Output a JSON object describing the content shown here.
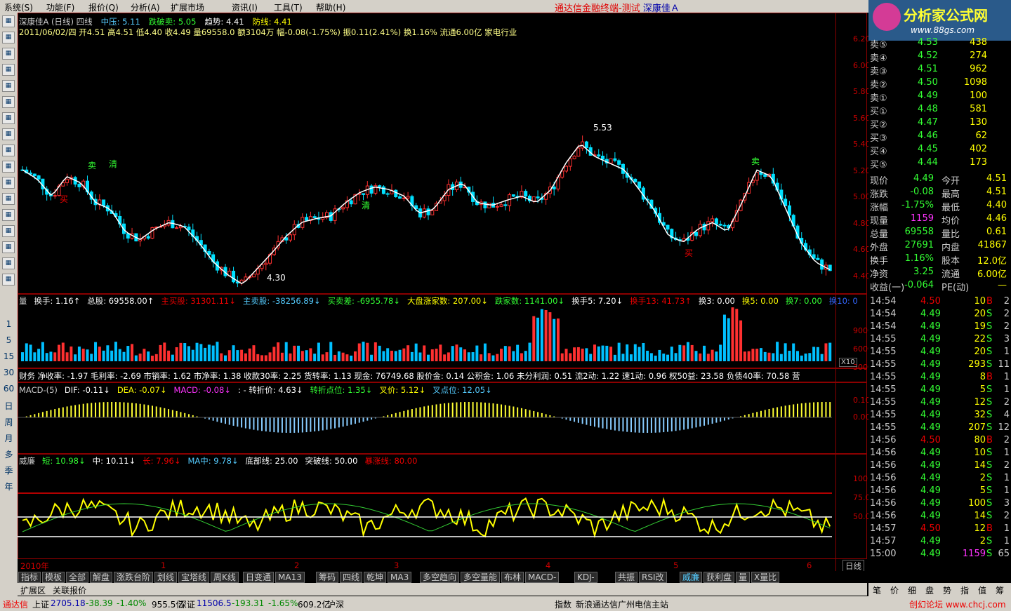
{
  "menu": [
    "系统(S)",
    "功能(F)",
    "报价(Q)",
    "分析(A)",
    "扩展市场",
    "资讯(I)",
    "工具(T)",
    "帮助(H)"
  ],
  "app_title": "通达信金融终端-测试",
  "stock_title": "深康佳Ａ",
  "chart_header": {
    "line1_name": "深康佳A (日线) 四线",
    "zhongya": "中压: 5.11",
    "diepo": "跌破卖: 5.05",
    "qushi": "趋势: 4.41",
    "fangxian": "防线: 4.41",
    "line2": "2011/06/02/四 开4.51 高4.51 低4.40 收4.49 量69558.0 额3104万 幅-0.08(-1.75%) 振0.11(2.41%) 换1.16% 流通6.00亿 家电行业"
  },
  "price_axis": [
    "6.20",
    "6.00",
    "5.80",
    "5.60",
    "5.40",
    "5.20",
    "5.00",
    "4.80",
    "4.60",
    "4.40"
  ],
  "annotations": {
    "high": "5.53",
    "low": "4.30",
    "buy": "买",
    "sell": "卖",
    "clear": "清"
  },
  "vol_header": [
    {
      "t": "量",
      "c": "#ccc"
    },
    {
      "t": "换手: 1.16↑",
      "c": "#fff"
    },
    {
      "t": "总股: 69558.00↑",
      "c": "#fff"
    },
    {
      "t": "主买股: 31301.11↓",
      "c": "#e00"
    },
    {
      "t": "主卖股: -38256.89↓",
      "c": "#5cf"
    },
    {
      "t": "买卖差: -6955.78↓",
      "c": "#3f3"
    },
    {
      "t": "大盘涨家数: 207.00↓",
      "c": "#ff0"
    },
    {
      "t": "跌家数: 1141.00↓",
      "c": "#3f3"
    },
    {
      "t": "换手5: 7.20↓",
      "c": "#fff"
    },
    {
      "t": "换手13: 41.73↑",
      "c": "#e00"
    },
    {
      "t": "换3: 0.00",
      "c": "#fff"
    },
    {
      "t": "换5: 0.00",
      "c": "#ff0"
    },
    {
      "t": "换7: 0.00",
      "c": "#3f3"
    },
    {
      "t": "换10: 0",
      "c": "#36f"
    }
  ],
  "vol_axis": [
    "90000",
    "60000",
    "30000"
  ],
  "vol_unit": "X10",
  "fin_header": "财务  净收率: -1.97  毛利率: -2.69  市销率: 1.62  市净率: 1.38  收款30率: 2.25  货转率: 1.13  现金: 76749.68  股价金: 0.14  公积金: 1.06  未分利润: 0.51  流2动: 1.22  速1动: 0.96  权50益: 23.58  负债40率: 70.58  营",
  "macd_header": [
    {
      "t": "MACD-(5)",
      "c": "#ccc"
    },
    {
      "t": "DIF: -0.11↓",
      "c": "#fff"
    },
    {
      "t": "DEA: -0.07↓",
      "c": "#ff0"
    },
    {
      "t": "MACD: -0.08↓",
      "c": "#f3f"
    },
    {
      "t": ": - 转折价: 4.63↓",
      "c": "#fff"
    },
    {
      "t": "转折点位: 1.35↓",
      "c": "#3f3"
    },
    {
      "t": "叉价: 5.12↓",
      "c": "#ff0"
    },
    {
      "t": "叉点位: 12.05↓",
      "c": "#5cf"
    }
  ],
  "macd_axis": [
    "0.10",
    "0.00"
  ],
  "wk_header": [
    {
      "t": "威廉",
      "c": "#ccc"
    },
    {
      "t": "短: 10.98↓",
      "c": "#3f3"
    },
    {
      "t": "中: 10.11↓",
      "c": "#fff"
    },
    {
      "t": "长: 7.96↓",
      "c": "#e00"
    },
    {
      "t": "MA中: 9.78↓",
      "c": "#5cf"
    },
    {
      "t": "底部线: 25.00",
      "c": "#fff"
    },
    {
      "t": "突破线: 50.00",
      "c": "#fff"
    },
    {
      "t": "暴涨线: 80.00",
      "c": "#e00"
    }
  ],
  "wk_axis": [
    "100.0",
    "75.00",
    "50.00"
  ],
  "time_axis": [
    "2010年",
    "1",
    "2",
    "3",
    "4",
    "5",
    "6"
  ],
  "period": "日线",
  "tabs": [
    "指标",
    "模板",
    "全部",
    "解盘",
    "涨跌台阶",
    "划线",
    "宝塔线",
    "周K线",
    "日变通",
    "MA13",
    "筹码",
    "四线",
    "乾坤",
    "MA3",
    "多空趋向",
    "多空量能",
    "布林",
    "MACD-",
    "KDJ-",
    "共振",
    "RSI改",
    "威廉",
    "获利盘",
    "量",
    "X量比"
  ],
  "ext_tabs": [
    "扩展区",
    "关联报价"
  ],
  "left_tools": [
    "1",
    "5",
    "15",
    "30",
    "60",
    "日",
    "周",
    "月",
    "多",
    "季",
    "年"
  ],
  "order_book": [
    {
      "l": "卖⑤",
      "p": "4.53",
      "v": "438"
    },
    {
      "l": "卖④",
      "p": "4.52",
      "v": "274"
    },
    {
      "l": "卖③",
      "p": "4.51",
      "v": "962"
    },
    {
      "l": "卖②",
      "p": "4.50",
      "v": "1098"
    },
    {
      "l": "卖①",
      "p": "4.49",
      "v": "100"
    },
    {
      "l": "买①",
      "p": "4.48",
      "v": "581"
    },
    {
      "l": "买②",
      "p": "4.47",
      "v": "130"
    },
    {
      "l": "买③",
      "p": "4.46",
      "v": "62"
    },
    {
      "l": "买④",
      "p": "4.45",
      "v": "402"
    },
    {
      "l": "买⑤",
      "p": "4.44",
      "v": "173"
    }
  ],
  "quote": [
    {
      "a": "现价",
      "av": "4.49",
      "b": "今开",
      "bv": "4.51"
    },
    {
      "a": "涨跌",
      "av": "-0.08",
      "b": "最高",
      "bv": "4.51"
    },
    {
      "a": "涨幅",
      "av": "-1.75%",
      "b": "最低",
      "bv": "4.40"
    },
    {
      "a": "现量",
      "av": "1159",
      "b": "均价",
      "bv": "4.46"
    },
    {
      "a": "总量",
      "av": "69558",
      "b": "量比",
      "bv": "0.61"
    },
    {
      "a": "外盘",
      "av": "27691",
      "b": "内盘",
      "bv": "41867"
    },
    {
      "a": "换手",
      "av": "1.16%",
      "b": "股本",
      "bv": "12.0亿"
    },
    {
      "a": "净资",
      "av": "3.25",
      "b": "流通",
      "bv": "6.00亿"
    },
    {
      "a": "收益(一)",
      "av": "-0.064",
      "b": "PE(动)",
      "bv": "—"
    }
  ],
  "ticks": [
    [
      "14:54",
      "4.50",
      "10",
      "B",
      "2"
    ],
    [
      "14:54",
      "4.49",
      "20",
      "S",
      "2"
    ],
    [
      "14:54",
      "4.49",
      "19",
      "S",
      "2"
    ],
    [
      "14:55",
      "4.49",
      "22",
      "S",
      "3"
    ],
    [
      "14:55",
      "4.49",
      "20",
      "S",
      "1"
    ],
    [
      "14:55",
      "4.49",
      "293",
      "S",
      "11"
    ],
    [
      "14:55",
      "4.49",
      "8",
      "B",
      "1"
    ],
    [
      "14:55",
      "4.49",
      "5",
      "S",
      "1"
    ],
    [
      "14:55",
      "4.49",
      "12",
      "S",
      "2"
    ],
    [
      "14:55",
      "4.49",
      "32",
      "S",
      "4"
    ],
    [
      "14:55",
      "4.49",
      "207",
      "S",
      "12"
    ],
    [
      "14:56",
      "4.50",
      "80",
      "B",
      "2"
    ],
    [
      "14:56",
      "4.49",
      "10",
      "S",
      "1"
    ],
    [
      "14:56",
      "4.49",
      "14",
      "S",
      "2"
    ],
    [
      "14:56",
      "4.49",
      "2",
      "S",
      "1"
    ],
    [
      "14:56",
      "4.49",
      "5",
      "S",
      "1"
    ],
    [
      "14:56",
      "4.49",
      "100",
      "S",
      "3"
    ],
    [
      "14:56",
      "4.49",
      "14",
      "S",
      "2"
    ],
    [
      "14:57",
      "4.50",
      "12",
      "B",
      "1"
    ],
    [
      "14:57",
      "4.49",
      "2",
      "S",
      "1"
    ],
    [
      "15:00",
      "4.49",
      "1159",
      "S",
      "65"
    ]
  ],
  "side_tabs": [
    "笔",
    "价",
    "细",
    "盘",
    "势",
    "指",
    "值",
    "筹"
  ],
  "logo_text": "分析家公式网",
  "logo_url": "www.88gs.com",
  "status": {
    "brand": "通达信",
    "sh": "上证",
    "sh_v": "2705.18",
    "sh_c": "-38.39",
    "sh_p": "-1.40%",
    "sh_a": "955.5亿",
    "sz": "深证",
    "sz_v": "11506.5",
    "sz_c": "-193.31",
    "sz_p": "-1.65%",
    "sz_a": "609.2亿",
    "hs": "沪深",
    "idx": "指数",
    "srv": "新浪通达信广州电信主站",
    "wm": "创幻论坛 www.chcj.com"
  }
}
